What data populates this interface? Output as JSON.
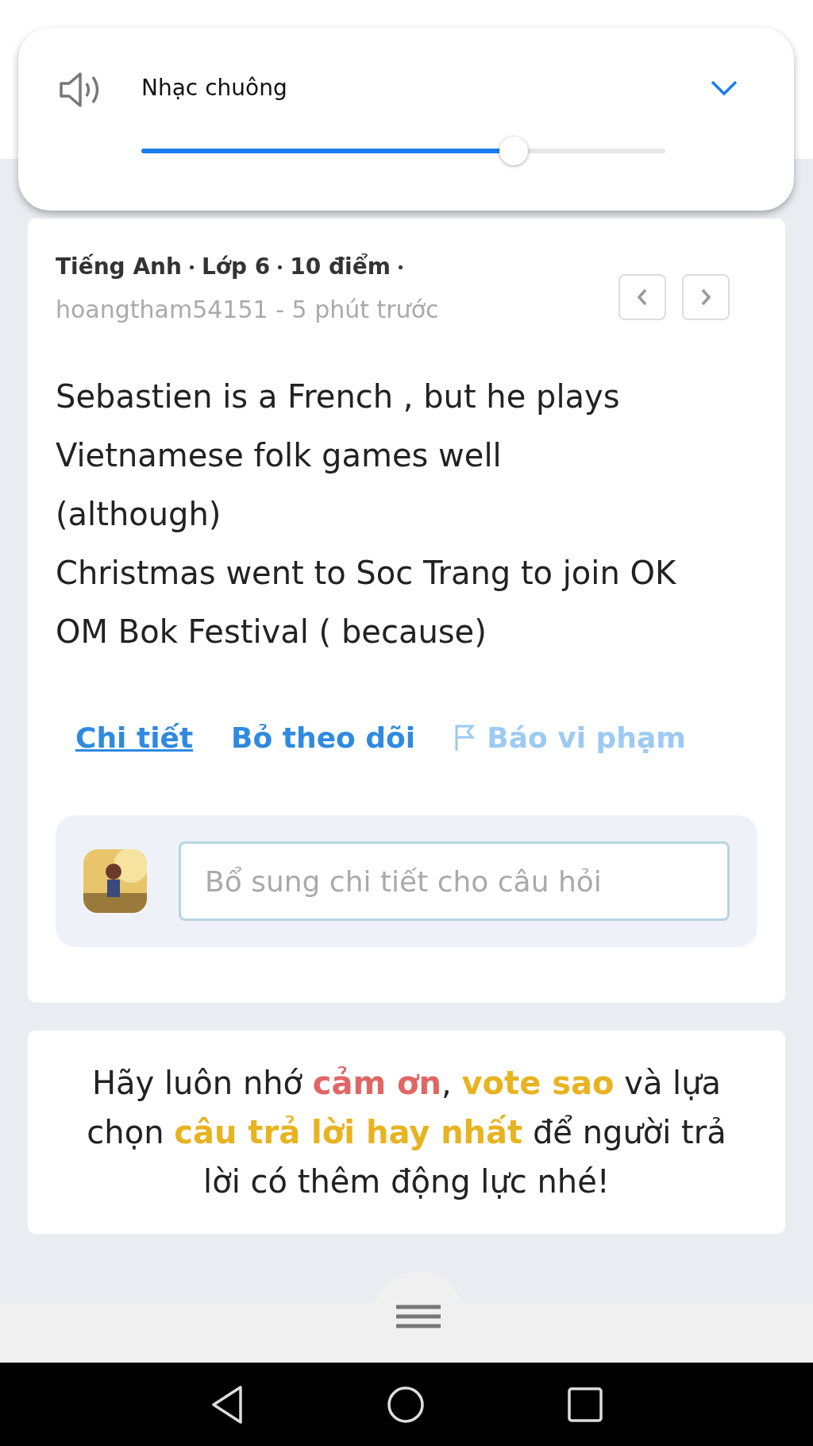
{
  "volume_panel": {
    "label": "Nhạc chuông",
    "level": 0.71
  },
  "question": {
    "meta": [
      "Tiếng Anh",
      "Lớp 6",
      "10 điểm"
    ],
    "author_line": "hoangtham54151 - 5 phút trước",
    "body": [
      "Sebastien is a French , but he plays Vietnamese folk games well",
      "(although)",
      "Christmas went to Soc Trang to join OK OM Bok Festival ( because)"
    ],
    "actions": [
      {
        "label": "Chi tiết",
        "kind": "underlined"
      },
      {
        "label": "Bỏ theo dõi",
        "kind": "plain"
      },
      {
        "label": "Báo vi phạm",
        "kind": "flag"
      }
    ],
    "comment": {
      "placeholder": "Bổ sung chi tiết cho câu hỏi"
    }
  },
  "reminder": {
    "parts": [
      {
        "text": "Hãy luôn nhớ ",
        "kind": "plain"
      },
      {
        "text": "cảm ơn",
        "kind": "thanks"
      },
      {
        "text": ", ",
        "kind": "plain"
      },
      {
        "text": "vote sao",
        "kind": "highlight"
      },
      {
        "text": " và lựa chọn ",
        "kind": "plain"
      },
      {
        "text": "câu trả lời hay nhất",
        "kind": "highlight"
      },
      {
        "text": " để người trả lời có thêm động lực nhé!",
        "kind": "plain"
      }
    ]
  }
}
